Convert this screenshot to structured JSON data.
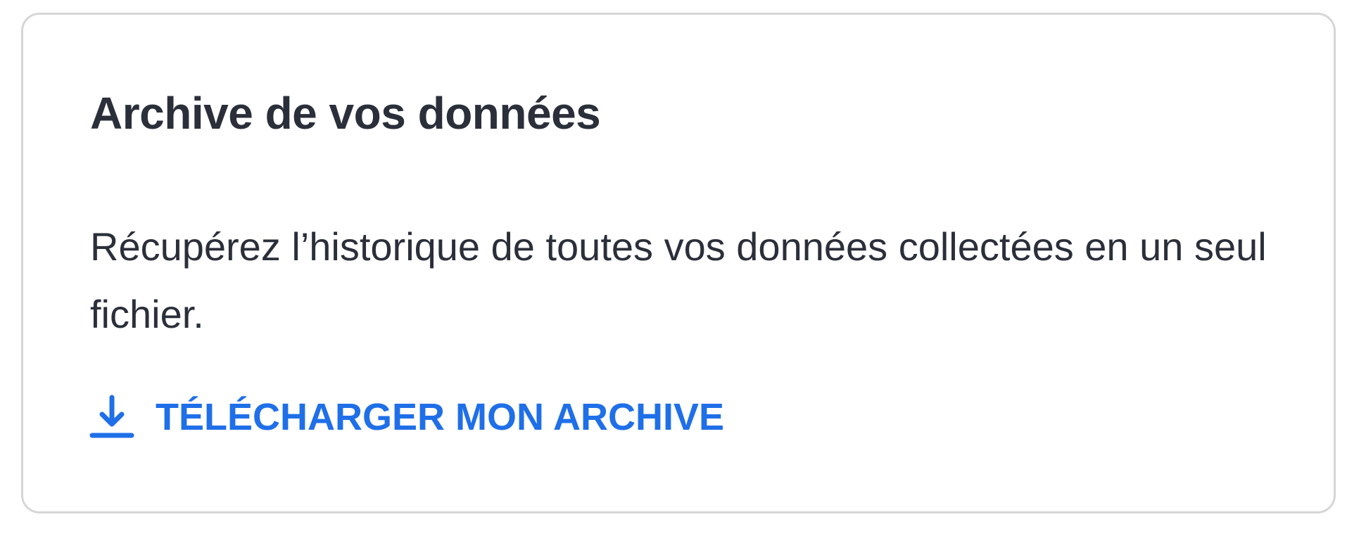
{
  "card": {
    "title": "Archive de vos données",
    "description": "Récupérez l’historique de toutes vos données collectées en un seul fichier.",
    "action": {
      "label": "TÉLÉCHARGER MON ARCHIVE",
      "icon": "download-icon"
    }
  },
  "colors": {
    "text": "#2b2f3a",
    "accent": "#1f6fe8",
    "border": "#d6d6d6"
  }
}
